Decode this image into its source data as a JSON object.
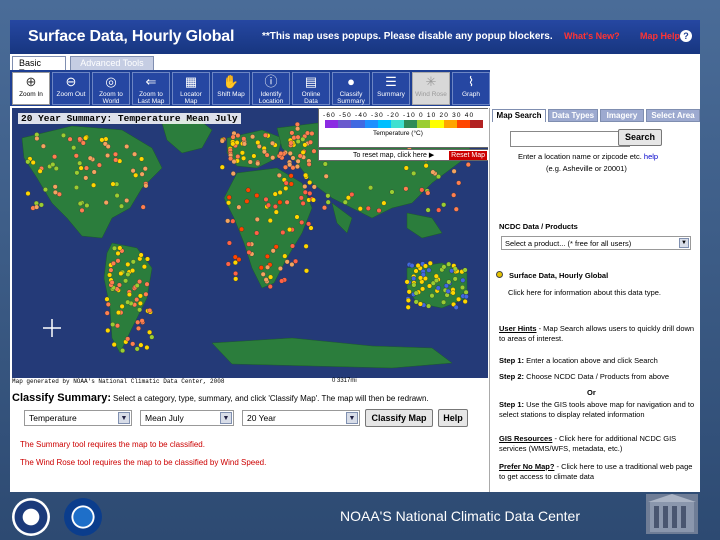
{
  "header": {
    "title": "Surface Data, Hourly Global",
    "popup_note": "**This map uses popups. Please disable any popup blockers.",
    "whats_new": "What's New?",
    "help": "Map Help",
    "help_icon": "?"
  },
  "tabs": {
    "basic": "Basic Tools",
    "advanced": "Advanced Tools"
  },
  "toolbar": [
    {
      "label": "Zoom In",
      "icon": "zoom-in-icon",
      "glyph": "⊕"
    },
    {
      "label": "Zoom Out",
      "icon": "zoom-out-icon",
      "glyph": "⊖"
    },
    {
      "label": "Zoom to\nWorld",
      "icon": "globe-icon",
      "glyph": "◎"
    },
    {
      "label": "Zoom to\nLast Map",
      "icon": "back-arrow-icon",
      "glyph": "⇐"
    },
    {
      "label": "Locator\nMap",
      "icon": "locator-map-icon",
      "glyph": "▦"
    },
    {
      "label": "Shift Map",
      "icon": "hand-icon",
      "glyph": "✋"
    },
    {
      "label": "Identify\nLocation",
      "icon": "identify-icon",
      "glyph": "ⓘ"
    },
    {
      "label": "Online\nData",
      "icon": "database-icon",
      "glyph": "▤"
    },
    {
      "label": "Classify\nSummary",
      "icon": "classify-icon",
      "glyph": "●"
    },
    {
      "label": "Summary",
      "icon": "summary-icon",
      "glyph": "☰"
    },
    {
      "label": "Wind Rose",
      "icon": "wind-rose-icon",
      "glyph": "✳"
    },
    {
      "label": "Graph",
      "icon": "graph-icon",
      "glyph": "⌇"
    }
  ],
  "map": {
    "title": "20 Year Summary: Temperature Mean July",
    "legend_scale": "-60 -50 -40 -30 -20 -10  0  10  20  30  40",
    "legend_unit": "Temperature (°C)",
    "legend_colors": [
      "#8b2be2",
      "#6a5acd",
      "#4169e1",
      "#1e90ff",
      "#00bfff",
      "#40e0d0",
      "#2e8b57",
      "#9acd32",
      "#ffff00",
      "#ffa500",
      "#ff4500",
      "#b22222"
    ],
    "reset_text": "To reset map, click here ▶",
    "reset_button": "Reset Map",
    "attribution": "Map generated by NOAA's National Climatic Data Center, 2008",
    "scale": "0     3317mi"
  },
  "classify": {
    "heading": "Classify Summary:",
    "description": "Select a category, type, summary, and click 'Classify Map'. The map will then be redrawn.",
    "category": "Temperature",
    "type": "Mean July",
    "summary": "20 Year",
    "classify_button": "Classify Map",
    "help_button": "Help",
    "note1": "The Summary tool requires the map to be classified.",
    "note2": "The Wind Rose tool requires the map to be classified by Wind Speed."
  },
  "right_panel": {
    "tabs": [
      "Map Search",
      "Data Types",
      "Imagery",
      "Select Area"
    ],
    "search_button": "Search",
    "search_hint": "Enter a location name or zipcode etc.",
    "help_link": "help",
    "example": "(e.g. Asheville or 20001)",
    "products_heading": "NCDC Data / Products",
    "product_select": "Select a product... (* free for all users)",
    "dataset_name": "Surface Data, Hourly Global",
    "dataset_info": "Click here for information about this data type.",
    "user_hints_label": "User Hints",
    "user_hints": " - Map Search allows users to quickly drill down to areas of interest.",
    "step1_label": "Step 1:",
    "step1": " Enter a location above and click Search",
    "step2_label": "Step 2:",
    "step2": " Choose NCDC Data / Products from above",
    "or": "Or",
    "step1b_label": "Step 1:",
    "step1b": " Use the GIS tools above map for navigation and to select stations to display related information",
    "gis_label": "GIS Resources",
    "gis": " - Click here for additional NCDC GIS services (WMS/WFS, metadata, etc.)",
    "prefer_label": "Prefer No Map?",
    "prefer": " - Click here to use a traditional web page to get access to climate data"
  },
  "footer": {
    "text": "NOAA'S National Climatic Data Center"
  }
}
